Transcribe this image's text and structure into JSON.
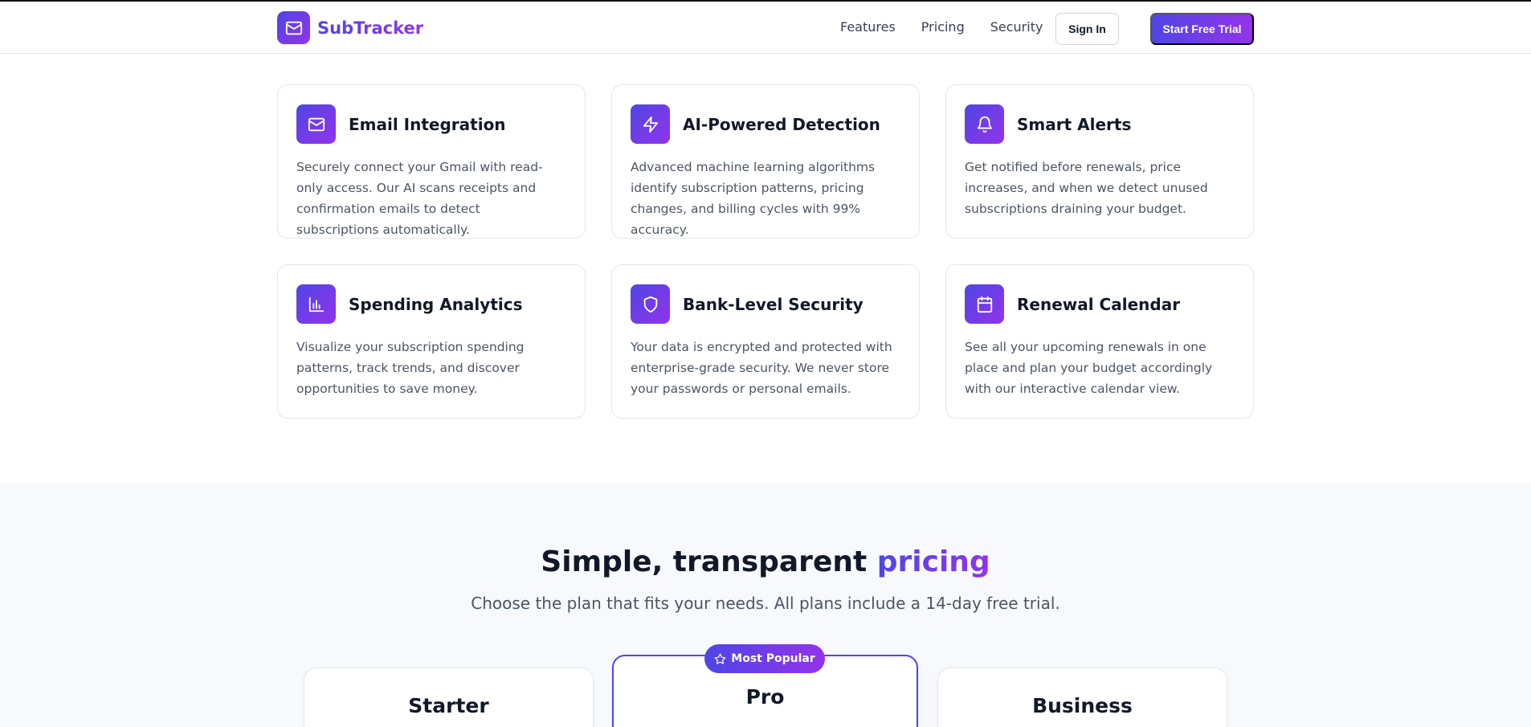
{
  "nav": {
    "brand": "SubTracker",
    "links": [
      "Features",
      "Pricing",
      "Security"
    ],
    "sign_in": "Sign In",
    "trial": "Start Free Trial"
  },
  "features": [
    {
      "title": "Email Integration",
      "icon": "mail-icon",
      "desc": "Securely connect your Gmail with read-only access. Our AI scans receipts and confirmation emails to detect subscriptions automatically."
    },
    {
      "title": "AI-Powered Detection",
      "icon": "lightning-icon",
      "desc": "Advanced machine learning algorithms identify subscription patterns, pricing changes, and billing cycles with 99% accuracy."
    },
    {
      "title": "Smart Alerts",
      "icon": "bell-icon",
      "desc": "Get notified before renewals, price increases, and when we detect unused subscriptions draining your budget."
    },
    {
      "title": "Spending Analytics",
      "icon": "bar-chart-icon",
      "desc": "Visualize your subscription spending patterns, track trends, and discover opportunities to save money."
    },
    {
      "title": "Bank-Level Security",
      "icon": "shield-icon",
      "desc": "Your data is encrypted and protected with enterprise-grade security. We never store your passwords or personal emails."
    },
    {
      "title": "Renewal Calendar",
      "icon": "calendar-icon",
      "desc": "See all your upcoming renewals in one place and plan your budget accordingly with our interactive calendar view."
    }
  ],
  "pricing": {
    "title_main": "Simple, transparent ",
    "title_accent": "pricing",
    "subtitle": "Choose the plan that fits your needs. All plans include a 14-day free trial.",
    "badge": "Most Popular",
    "plans": [
      "Starter",
      "Pro",
      "Business"
    ]
  },
  "colors": {
    "gradient_start": "#4f46e5",
    "gradient_end": "#9333ea",
    "pricing_bg": "#f8f9fc"
  }
}
